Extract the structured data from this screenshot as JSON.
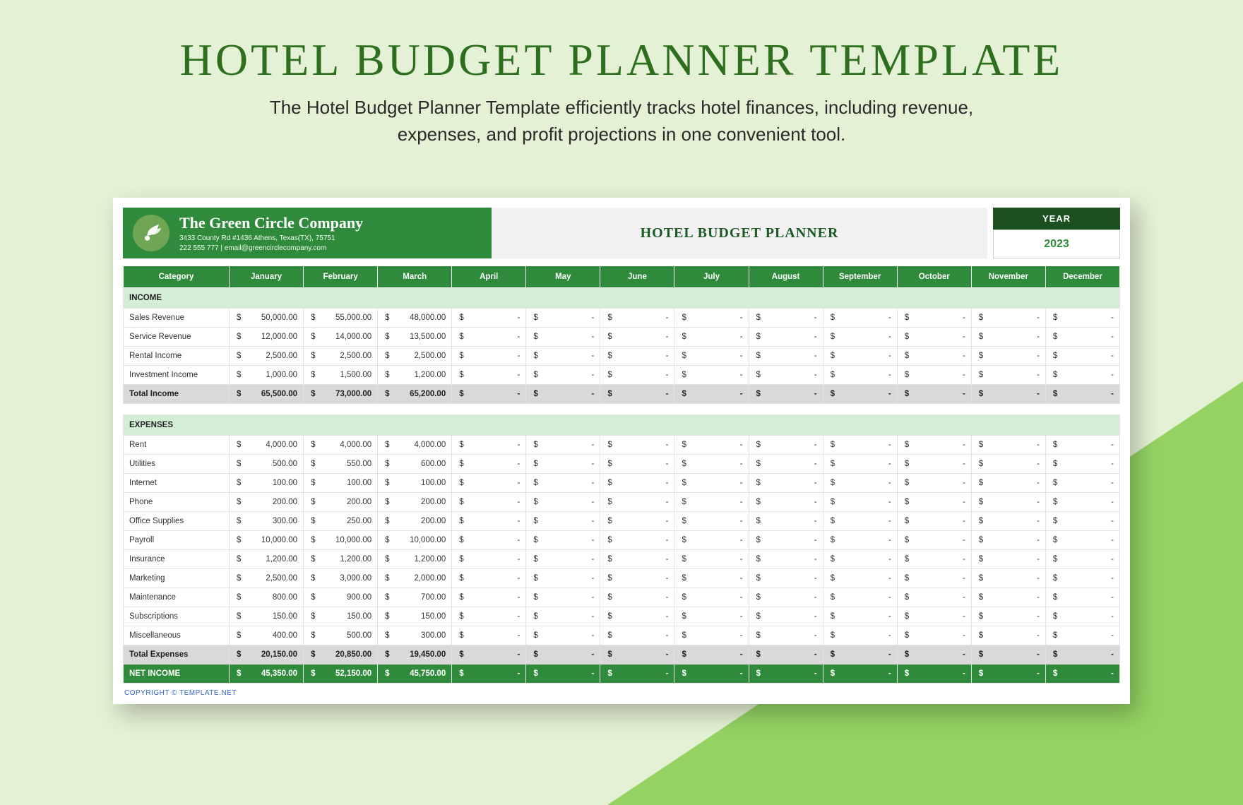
{
  "page": {
    "title": "HOTEL BUDGET PLANNER TEMPLATE",
    "subtitle1": "The Hotel Budget Planner Template efficiently tracks hotel finances, including revenue,",
    "subtitle2": "expenses, and profit projections in one convenient tool."
  },
  "header": {
    "company_name": "The Green Circle Company",
    "address": "3433 County Rd #1436 Athens, Texas(TX), 75751",
    "contact": "222 555 777  |  email@greencirclecompany.com",
    "planner_title": "HOTEL BUDGET PLANNER",
    "year_label": "YEAR",
    "year_value": "2023"
  },
  "months": [
    "January",
    "February",
    "March",
    "April",
    "May",
    "June",
    "July",
    "August",
    "September",
    "October",
    "November",
    "December"
  ],
  "category_label": "Category",
  "currency": "$",
  "dash": "-",
  "sections": {
    "income_label": "INCOME",
    "expenses_label": "EXPENSES",
    "total_income_label": "Total Income",
    "total_expenses_label": "Total Expenses",
    "net_income_label": "NET INCOME"
  },
  "income": [
    {
      "name": "Sales Revenue",
      "vals": [
        "50,000.00",
        "55,000.00",
        "48,000.00",
        "-",
        "-",
        "-",
        "-",
        "-",
        "-",
        "-",
        "-",
        "-"
      ]
    },
    {
      "name": "Service Revenue",
      "vals": [
        "12,000.00",
        "14,000.00",
        "13,500.00",
        "-",
        "-",
        "-",
        "-",
        "-",
        "-",
        "-",
        "-",
        "-"
      ]
    },
    {
      "name": "Rental Income",
      "vals": [
        "2,500.00",
        "2,500.00",
        "2,500.00",
        "-",
        "-",
        "-",
        "-",
        "-",
        "-",
        "-",
        "-",
        "-"
      ]
    },
    {
      "name": "Investment Income",
      "vals": [
        "1,000.00",
        "1,500.00",
        "1,200.00",
        "-",
        "-",
        "-",
        "-",
        "-",
        "-",
        "-",
        "-",
        "-"
      ]
    }
  ],
  "total_income": [
    "65,500.00",
    "73,000.00",
    "65,200.00",
    "-",
    "-",
    "-",
    "-",
    "-",
    "-",
    "-",
    "-",
    "-"
  ],
  "expenses": [
    {
      "name": "Rent",
      "vals": [
        "4,000.00",
        "4,000.00",
        "4,000.00",
        "-",
        "-",
        "-",
        "-",
        "-",
        "-",
        "-",
        "-",
        "-"
      ]
    },
    {
      "name": "Utilities",
      "vals": [
        "500.00",
        "550.00",
        "600.00",
        "-",
        "-",
        "-",
        "-",
        "-",
        "-",
        "-",
        "-",
        "-"
      ]
    },
    {
      "name": "Internet",
      "vals": [
        "100.00",
        "100.00",
        "100.00",
        "-",
        "-",
        "-",
        "-",
        "-",
        "-",
        "-",
        "-",
        "-"
      ]
    },
    {
      "name": "Phone",
      "vals": [
        "200.00",
        "200.00",
        "200.00",
        "-",
        "-",
        "-",
        "-",
        "-",
        "-",
        "-",
        "-",
        "-"
      ]
    },
    {
      "name": "Office Supplies",
      "vals": [
        "300.00",
        "250.00",
        "200.00",
        "-",
        "-",
        "-",
        "-",
        "-",
        "-",
        "-",
        "-",
        "-"
      ]
    },
    {
      "name": "Payroll",
      "vals": [
        "10,000.00",
        "10,000.00",
        "10,000.00",
        "-",
        "-",
        "-",
        "-",
        "-",
        "-",
        "-",
        "-",
        "-"
      ]
    },
    {
      "name": "Insurance",
      "vals": [
        "1,200.00",
        "1,200.00",
        "1,200.00",
        "-",
        "-",
        "-",
        "-",
        "-",
        "-",
        "-",
        "-",
        "-"
      ]
    },
    {
      "name": "Marketing",
      "vals": [
        "2,500.00",
        "3,000.00",
        "2,000.00",
        "-",
        "-",
        "-",
        "-",
        "-",
        "-",
        "-",
        "-",
        "-"
      ]
    },
    {
      "name": "Maintenance",
      "vals": [
        "800.00",
        "900.00",
        "700.00",
        "-",
        "-",
        "-",
        "-",
        "-",
        "-",
        "-",
        "-",
        "-"
      ]
    },
    {
      "name": "Subscriptions",
      "vals": [
        "150.00",
        "150.00",
        "150.00",
        "-",
        "-",
        "-",
        "-",
        "-",
        "-",
        "-",
        "-",
        "-"
      ]
    },
    {
      "name": "Miscellaneous",
      "vals": [
        "400.00",
        "500.00",
        "300.00",
        "-",
        "-",
        "-",
        "-",
        "-",
        "-",
        "-",
        "-",
        "-"
      ]
    }
  ],
  "total_expenses": [
    "20,150.00",
    "20,850.00",
    "19,450.00",
    "-",
    "-",
    "-",
    "-",
    "-",
    "-",
    "-",
    "-",
    "-"
  ],
  "net_income": [
    "45,350.00",
    "52,150.00",
    "45,750.00",
    "-",
    "-",
    "-",
    "-",
    "-",
    "-",
    "-",
    "-",
    "-"
  ],
  "copyright": "COPYRIGHT © TEMPLATE.NET"
}
